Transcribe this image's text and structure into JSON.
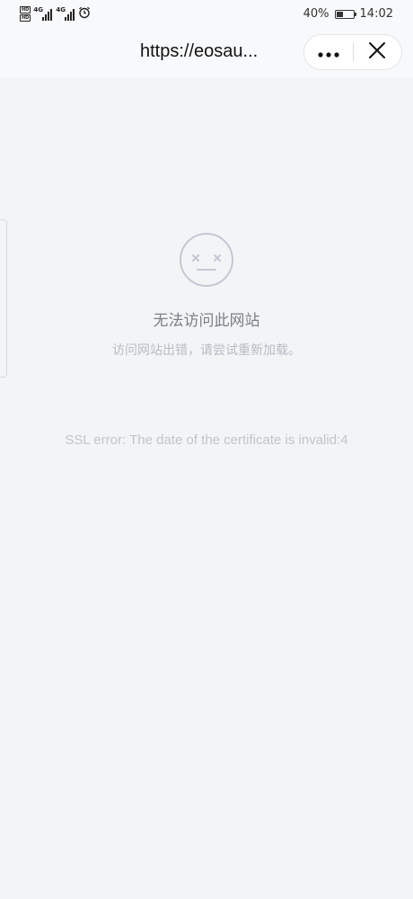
{
  "status_bar": {
    "left_badges": [
      "HD",
      "HD"
    ],
    "network_labels": [
      "4G",
      "4G"
    ],
    "alarm_icon": "alarm-clock-icon",
    "battery_text": "40%",
    "battery_level": 0.4,
    "time": "14:02"
  },
  "nav": {
    "title": "https://eosau...",
    "more_icon": "more-dots-icon",
    "close_icon": "close-icon"
  },
  "error": {
    "icon": "dizzy-face-icon",
    "title": "无法访问此网站",
    "subtitle": "访问网站出错，请尝试重新加载。",
    "detail": "SSL error: The date of the certificate is invalid:4"
  },
  "colors": {
    "background": "#f3f4f6",
    "title_text": "#7c7f88",
    "subtitle_text": "#b9bbc4",
    "icon_stroke": "#c5c8d3"
  }
}
